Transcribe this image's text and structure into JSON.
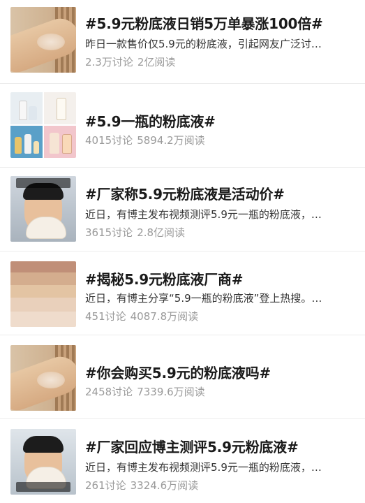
{
  "items": [
    {
      "title": "#5.9元粉底液日销5万单暴涨100倍#",
      "description": "昨日一款售价仅5.9元的粉底液，引起网友广泛讨…",
      "discussions": "2.3万讨论",
      "reads": "2亿阅读",
      "thumbnail": "arm-swatch-photo"
    },
    {
      "title": "#5.9一瓶的粉底液#",
      "description": "",
      "discussions": "4015讨论",
      "reads": "5894.2万阅读",
      "thumbnail": "product-bottles-grid"
    },
    {
      "title": "#厂家称5.9元粉底液是活动价#",
      "description": "近日，有博主发布视频测评5.9元一瓶的粉底液，…",
      "discussions": "3615讨论",
      "reads": "2.8亿阅读",
      "thumbnail": "blogger-face-photo"
    },
    {
      "title": "#揭秘5.9元粉底液厂商#",
      "description": "近日，有博主分享“5.9一瓶的粉底液”登上热搜。…",
      "discussions": "451讨论",
      "reads": "4087.8万阅读",
      "thumbnail": "color-swatches-photo"
    },
    {
      "title": "#你会购买5.9元的粉底液吗#",
      "description": "",
      "discussions": "2458讨论",
      "reads": "7339.6万阅读",
      "thumbnail": "arm-swatch-photo"
    },
    {
      "title": "#厂家回应博主测评5.9元粉底液#",
      "description": "近日，有博主发布视频测评5.9元一瓶的粉底液，…",
      "discussions": "261讨论",
      "reads": "3324.6万阅读",
      "thumbnail": "blogger-face-photo"
    }
  ]
}
